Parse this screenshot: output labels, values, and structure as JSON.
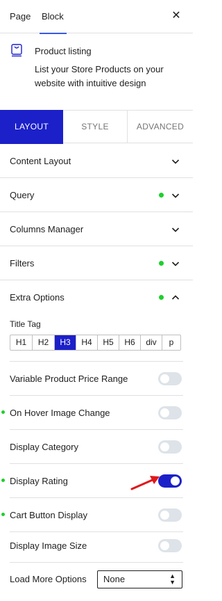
{
  "top_tabs": {
    "page": "Page",
    "block": "Block",
    "close": "✕"
  },
  "block_card": {
    "title": "Product listing",
    "description": "List your Store Products on your website with intuitive design"
  },
  "mode_tabs": {
    "layout": "LAYOUT",
    "style": "STYLE",
    "advanced": "ADVANCED"
  },
  "panels": [
    {
      "label": "Content Layout",
      "modified": false,
      "expanded": false
    },
    {
      "label": "Query",
      "modified": true,
      "expanded": false
    },
    {
      "label": "Columns Manager",
      "modified": false,
      "expanded": false
    },
    {
      "label": "Filters",
      "modified": true,
      "expanded": false
    },
    {
      "label": "Extra Options",
      "modified": true,
      "expanded": true
    }
  ],
  "extra_options": {
    "title_tag": {
      "label": "Title Tag",
      "options": [
        "H1",
        "H2",
        "H3",
        "H4",
        "H5",
        "H6",
        "div",
        "p"
      ],
      "selected": "H3"
    },
    "toggles": [
      {
        "label": "Variable Product Price Range",
        "on": false,
        "modified": false
      },
      {
        "label": "On Hover Image Change",
        "on": false,
        "modified": true
      },
      {
        "label": "Display Category",
        "on": false,
        "modified": false
      },
      {
        "label": "Display Rating",
        "on": true,
        "modified": true
      },
      {
        "label": "Cart Button Display",
        "on": false,
        "modified": true
      },
      {
        "label": "Display Image Size",
        "on": false,
        "modified": false
      }
    ],
    "load_more": {
      "label": "Load More Options",
      "value": "None"
    }
  },
  "colors": {
    "accent": "#1c20c9",
    "modified_dot": "#1ecf2c",
    "annotation_arrow": "#e0181b",
    "wp_focus": "#3858e9"
  },
  "icons": {
    "close": "close-icon",
    "block": "product-listing-icon",
    "chevron_down": "chevron-down-icon",
    "chevron_up": "chevron-up-icon",
    "select_arrows": "updown-arrows-icon",
    "annotation": "red-arrow-annotation"
  }
}
